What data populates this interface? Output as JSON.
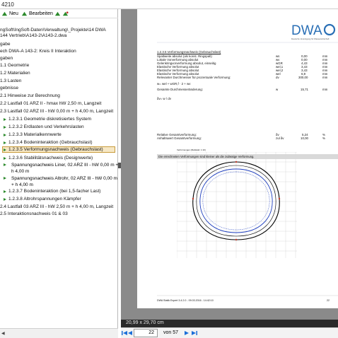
{
  "window": {
    "title": "4210"
  },
  "toolbar": {
    "new_label": "Neu",
    "edit_label": "Bearbeiten"
  },
  "tree": {
    "path_lines": [
      "ngSoft\\IngSoft-Daten\\Verwaltung\\_Projekte\\14 DWA",
      "144 Vertrieb\\A143-2\\A143-2.dwa"
    ],
    "items": [
      {
        "label": "gabe"
      },
      {
        "label": "ech DWA-A 143-2: Kreis II Interaktion"
      },
      {
        "label": "gaben"
      },
      {
        "label": "1.1 Geometrie"
      },
      {
        "label": "1.2 Materialien"
      },
      {
        "label": "1.3 Lasten"
      },
      {
        "label": "gebnisse"
      },
      {
        "label": "2.1 Hinweise zur Berechnung"
      },
      {
        "label": "2.2 Lastfall 01 ARZ II - hmax hW 2,50 m, Langzeit"
      },
      {
        "label": "2.3 Lastfall 02 ARZ III - hW 0,00 m + h 4,00 m, Langzeit"
      },
      {
        "label": "1.2.3.1 Geometrie diskretisiertes System"
      },
      {
        "label": "1.2.3.2 Erdlasten und Verkehrslasten"
      },
      {
        "label": "1.2.3.3 Materialkennwerte"
      },
      {
        "label": "1.2.3.4 Bodeninteraktion (Gebrauchslast)"
      },
      {
        "label": "1.2.3.5 Verformungsnachweis (Gebrauchslast)"
      },
      {
        "label": "1.2.3.6 Stabilitätsnachweis (Designwerte)"
      },
      {
        "label_lines": [
          "Spannungsnachweis  Liner, 02 ARZ III - hW 0,00 m +",
          "h 4,00 m"
        ]
      },
      {
        "label_lines": [
          "Spannungsnachweis  Altrohr, 02 ARZ III - hW 0,00 m",
          "+ h 4,00 m"
        ]
      },
      {
        "label": "1.2.3.7 Bodeninteraktion (bei 1,5-facher Last)"
      },
      {
        "label": "1.2.3.8 Altrohrspannungen Kämpfer"
      },
      {
        "label": "2.4 Lastfall 03 ARZ III - hW 2,50 m + h 4,00 m, Langzeit"
      },
      {
        "label": "2.5 Interaktionsnachweis 01 & 03"
      }
    ]
  },
  "document": {
    "logo_text": "DWA",
    "logo_tagline": "Deutsche Vereinigung für Wasserwirtschaft",
    "section_title": "1.2.3.5 Verformungsnachweis (Gebrauchslast)",
    "rows": [
      {
        "label": "Spaltweite absolut (als konst. Ringspalt)",
        "symbol": "ws",
        "value": "0,00",
        "unit": "mm"
      },
      {
        "label": "Lokale Vorverformung absolut",
        "symbol": "wv",
        "value": "0,00",
        "unit": "mm"
      },
      {
        "label": "Gelenkringvorverformung absolut, einseitig",
        "symbol": "wGR",
        "value": "4,43",
        "unit": "mm"
      },
      {
        "label": "Elastische Verformung absolut",
        "symbol": "wel,1",
        "value": "3,43",
        "unit": "mm"
      },
      {
        "label": "Elastische Verformung absolut",
        "symbol": "wel,2",
        "value": "3,43",
        "unit": "mm"
      },
      {
        "label": "Elastische Verformung absolut",
        "symbol": "wel",
        "value": "6,9",
        "unit": "mm"
      },
      {
        "label": "Relevanter Durchmesser für prozentuale Verformung:",
        "symbol": "dv",
        "value": "300,00",
        "unit": "mm"
      }
    ],
    "formula_line": "w= wel + wGR,f · 2 + wv",
    "total_label": "Gesamte Durchmesseränderung:",
    "total_symbol": "w",
    "total_value": "15,71",
    "total_unit": "mm",
    "ratio_formula": "δv= w / dv",
    "relative_label": "Relative Gesamtverformung:",
    "relative_symbol": "δv",
    "relative_value": "5,24",
    "relative_unit": "%",
    "allowed_label": "Anhaltswert Gesamtverformung:",
    "allowed_symbol": "zul δv",
    "allowed_value": "10,00",
    "allowed_unit": "%",
    "result_banner": "Die errechneten Verformungen sind kleiner als die zulässige Verformung.",
    "chart_caption": "Verformungen (Maßstab: 1:10)",
    "footer_left": "DWA Statik Expert 3.4.2.0 - 09.03.2016 - 14:42:10",
    "footer_right": "22"
  },
  "status": {
    "page_size": "20,99 x 29,70 cm",
    "current_page": "22",
    "page_count": "von 57"
  },
  "colors": {
    "outer_curve": "#000000",
    "inner_curve": "#1f3fbf",
    "selection": "#f6e7c4",
    "accent_nav": "#1a6ed8"
  }
}
